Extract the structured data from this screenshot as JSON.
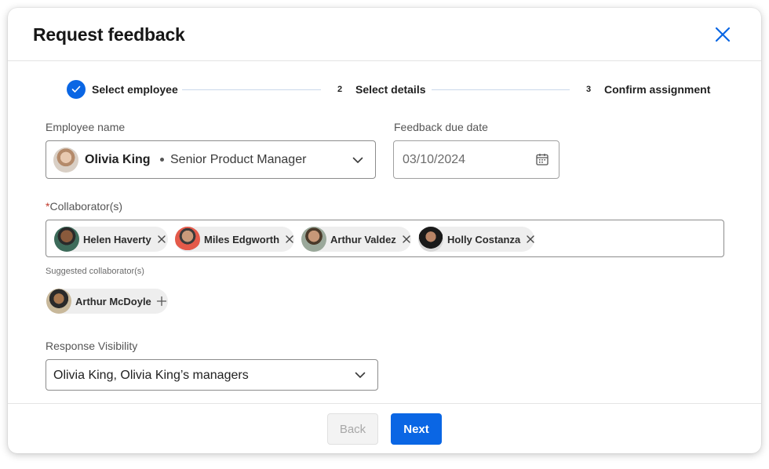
{
  "dialog": {
    "title": "Request feedback"
  },
  "steps": [
    {
      "number": "1",
      "label": "Select employee",
      "status": "complete"
    },
    {
      "number": "2",
      "label": "Select details",
      "status": "upcoming"
    },
    {
      "number": "3",
      "label": "Confirm assignment",
      "status": "upcoming"
    }
  ],
  "employee": {
    "label": "Employee name",
    "name": "Olivia King",
    "role": "Senior Product Manager"
  },
  "due_date": {
    "label": "Feedback due date",
    "value": "03/10/2024"
  },
  "collaborators": {
    "required_marker": "*",
    "label": "Collaborator(s)",
    "chips": [
      {
        "name": "Helen Haverty"
      },
      {
        "name": "Miles Edgworth"
      },
      {
        "name": "Arthur Valdez"
      },
      {
        "name": "Holly Costanza"
      }
    ]
  },
  "suggested": {
    "label": "Suggested collaborator(s)",
    "items": [
      {
        "name": "Arthur McDoyle"
      }
    ]
  },
  "visibility": {
    "label": "Response Visibility",
    "value": "Olivia King, Olivia King’s managers"
  },
  "footer": {
    "back_label": "Back",
    "next_label": "Next"
  },
  "colors": {
    "accent": "#0a66e4",
    "required": "#c0392b"
  }
}
